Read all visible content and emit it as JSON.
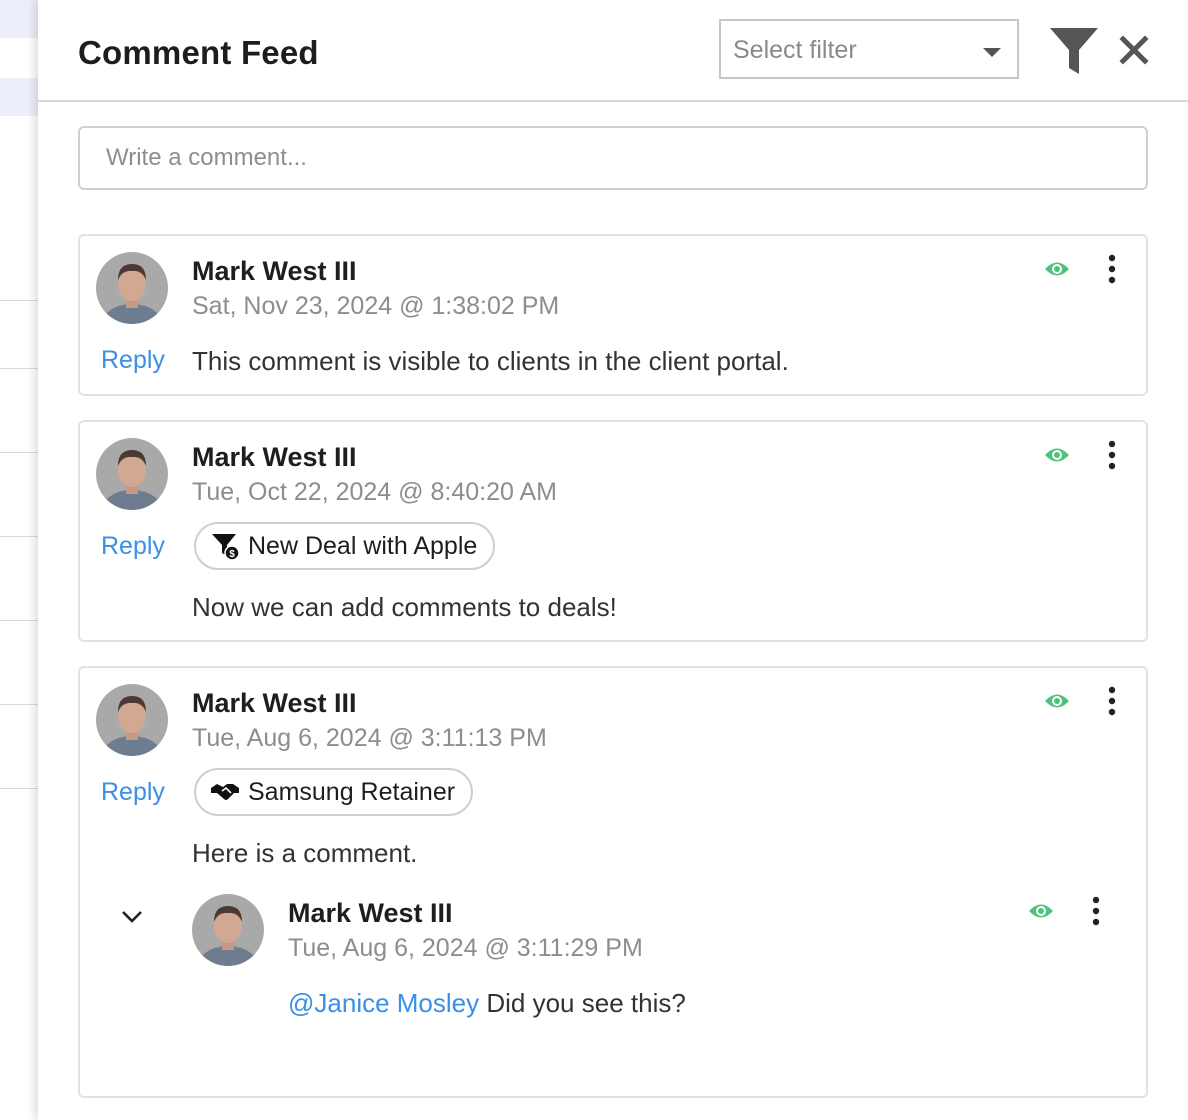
{
  "header": {
    "title": "Comment Feed",
    "filter_placeholder": "Select filter"
  },
  "composer": {
    "placeholder": "Write a comment..."
  },
  "comments": [
    {
      "author": "Mark West III",
      "timestamp": "Sat, Nov 23, 2024 @ 1:38:02 PM",
      "reply_label": "Reply",
      "text": "This comment is visible to clients in the client portal."
    },
    {
      "author": "Mark West III",
      "timestamp": "Tue, Oct 22, 2024 @ 8:40:20 AM",
      "reply_label": "Reply",
      "tag": {
        "label": "New Deal with Apple",
        "icon": "deal-funnel-icon"
      },
      "text": "Now we can add comments to deals!"
    },
    {
      "author": "Mark West III",
      "timestamp": "Tue, Aug 6, 2024 @ 3:11:13 PM",
      "reply_label": "Reply",
      "tag": {
        "label": "Samsung Retainer",
        "icon": "handshake-icon"
      },
      "text": "Here is a comment.",
      "replies": [
        {
          "author": "Mark West III",
          "timestamp": "Tue, Aug 6, 2024 @ 3:11:29 PM",
          "mention": "@Janice Mosley",
          "text": " Did you see this?"
        }
      ]
    }
  ],
  "colors": {
    "accent_blue": "#3b8fe6",
    "visible_green": "#4cc27a",
    "muted_text": "#8d8d8d"
  }
}
